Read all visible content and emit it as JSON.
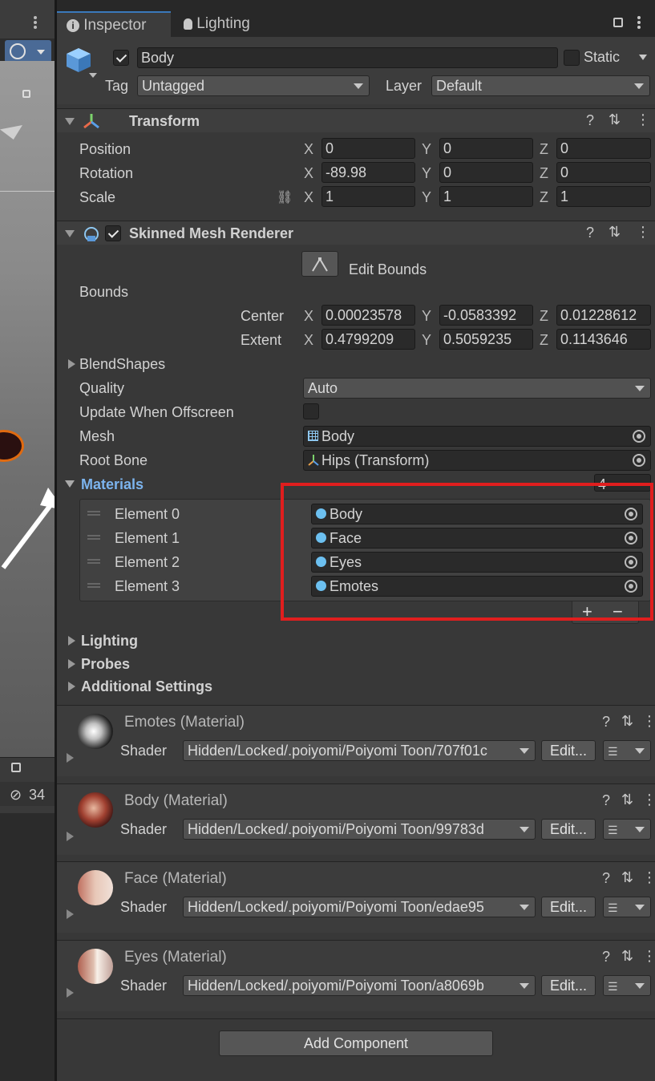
{
  "scene": {
    "hidden_count": "34"
  },
  "tabs": [
    {
      "label": "Inspector"
    },
    {
      "label": "Lighting"
    }
  ],
  "object": {
    "name": "Body",
    "static_label": "Static",
    "tag_label": "Tag",
    "tag_value": "Untagged",
    "layer_label": "Layer",
    "layer_value": "Default"
  },
  "transform": {
    "title": "Transform",
    "position": {
      "label": "Position",
      "x": "0",
      "y": "0",
      "z": "0"
    },
    "rotation": {
      "label": "Rotation",
      "x": "-89.98",
      "y": "0",
      "z": "0"
    },
    "scale": {
      "label": "Scale",
      "x": "1",
      "y": "1",
      "z": "1"
    }
  },
  "axes": {
    "x": "X",
    "y": "Y",
    "z": "Z"
  },
  "smr": {
    "title": "Skinned Mesh Renderer",
    "edit_bounds": "Edit Bounds",
    "bounds_label": "Bounds",
    "center": {
      "label": "Center",
      "x": "0.00023578",
      "y": "-0.0583392",
      "z": "0.01228612"
    },
    "extent": {
      "label": "Extent",
      "x": "0.4799209",
      "y": "0.5059235",
      "z": "0.1143646"
    },
    "blendshapes": "BlendShapes",
    "quality": {
      "label": "Quality",
      "value": "Auto"
    },
    "update_offscreen": "Update When Offscreen",
    "mesh": {
      "label": "Mesh",
      "value": "Body"
    },
    "root_bone": {
      "label": "Root Bone",
      "value": "Hips (Transform)"
    },
    "materials": {
      "label": "Materials",
      "count": "4",
      "elements": [
        {
          "label": "Element 0",
          "value": "Body"
        },
        {
          "label": "Element 1",
          "value": "Face"
        },
        {
          "label": "Element 2",
          "value": "Eyes"
        },
        {
          "label": "Element 3",
          "value": "Emotes"
        }
      ]
    },
    "lighting": "Lighting",
    "probes": "Probes",
    "additional": "Additional Settings"
  },
  "shader_label": "Shader",
  "edit_label": "Edit...",
  "material_sections": [
    {
      "title": "Emotes (Material)",
      "shader": "Hidden/Locked/.poiyomi/Poiyomi Toon/707f01c"
    },
    {
      "title": "Body (Material)",
      "shader": "Hidden/Locked/.poiyomi/Poiyomi Toon/99783d"
    },
    {
      "title": "Face (Material)",
      "shader": "Hidden/Locked/.poiyomi/Poiyomi Toon/edae95"
    },
    {
      "title": "Eyes (Material)",
      "shader": "Hidden/Locked/.poiyomi/Poiyomi Toon/a8069b"
    }
  ],
  "add_component": "Add Component",
  "colors": {
    "highlight": "#e01e1e",
    "accent": "#7cb4ee",
    "panel": "#383838"
  }
}
